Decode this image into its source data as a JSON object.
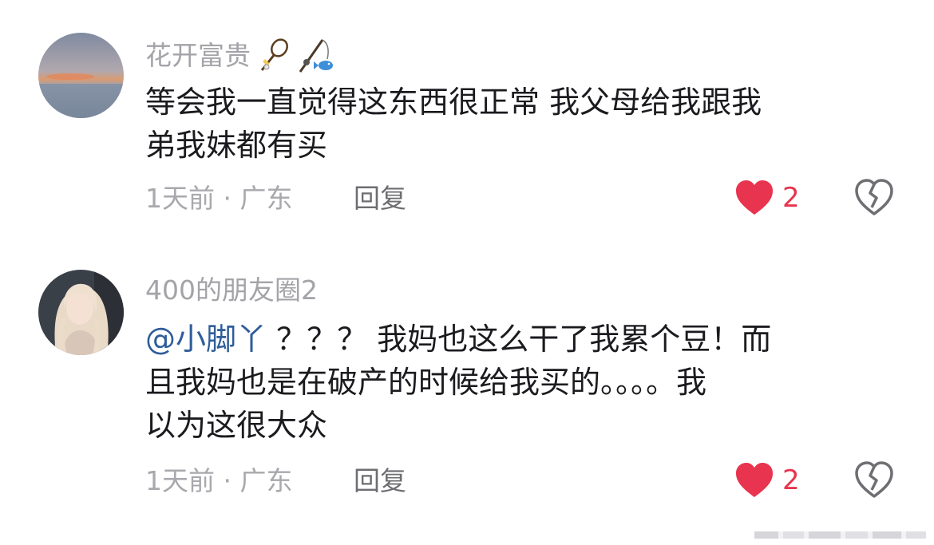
{
  "comments": [
    {
      "username": "花开富贵",
      "badges": [
        "badminton-icon",
        "fishing-icon"
      ],
      "text_lines": [
        "等会我一直觉得这东西很正常 我父母给我跟我",
        "弟我妹都有买"
      ],
      "time_location": "1天前 · 广东",
      "reply_label": "回复",
      "likes": "2"
    },
    {
      "username": "400的朋友圈2",
      "mention": "@小脚丫",
      "text_lines": [
        "？？？ 我妈也这么干了我累个豆！而",
        "且我妈也是在破产的时候给我买的。。。。我",
        "以为这很大众"
      ],
      "time_location": "1天前 · 广东",
      "reply_label": "回复",
      "likes": "2"
    }
  ],
  "colors": {
    "like": "#e8344e",
    "mention": "#2f5d9a",
    "username": "#a3a3a8",
    "body_text": "#1b1b1f"
  }
}
